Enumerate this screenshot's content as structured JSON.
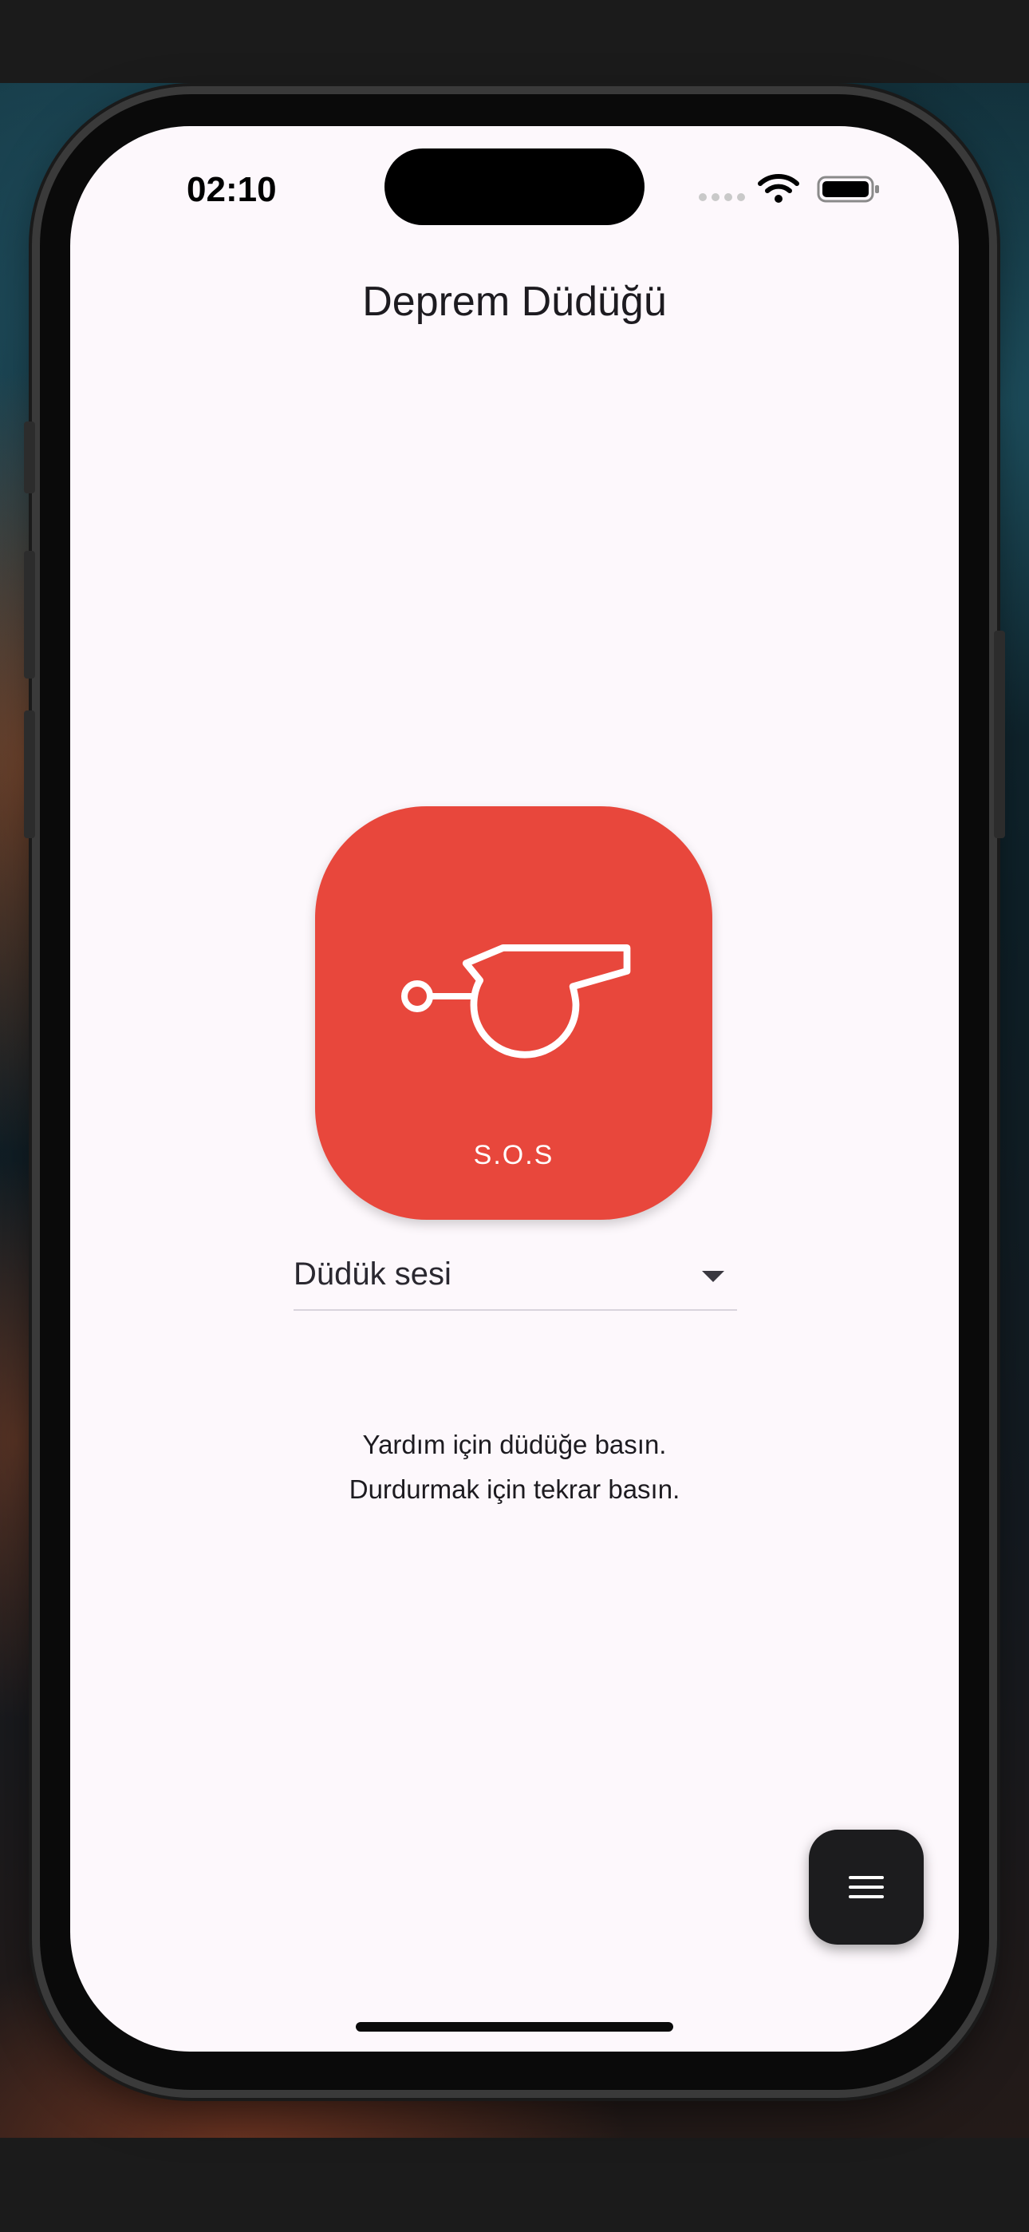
{
  "status_bar": {
    "time": "02:10",
    "icons": [
      "cellular-signal-icon",
      "wifi-icon",
      "battery-icon"
    ]
  },
  "app": {
    "title": "Deprem Düdüğü"
  },
  "sos_button": {
    "icon": "whistle-icon",
    "label": "S.O.S",
    "color": "#e8473c"
  },
  "sound_dropdown": {
    "selected": "Düdük sesi",
    "icon": "chevron-down-icon"
  },
  "instructions": {
    "line1": "Yardım için düdüğe basın.",
    "line2": "Durdurmak için tekrar basın."
  },
  "menu_fab": {
    "icon": "menu-icon",
    "color": "#1c1c1e"
  },
  "colors": {
    "screen_background": "#fdf8fc",
    "accent": "#e8473c"
  }
}
